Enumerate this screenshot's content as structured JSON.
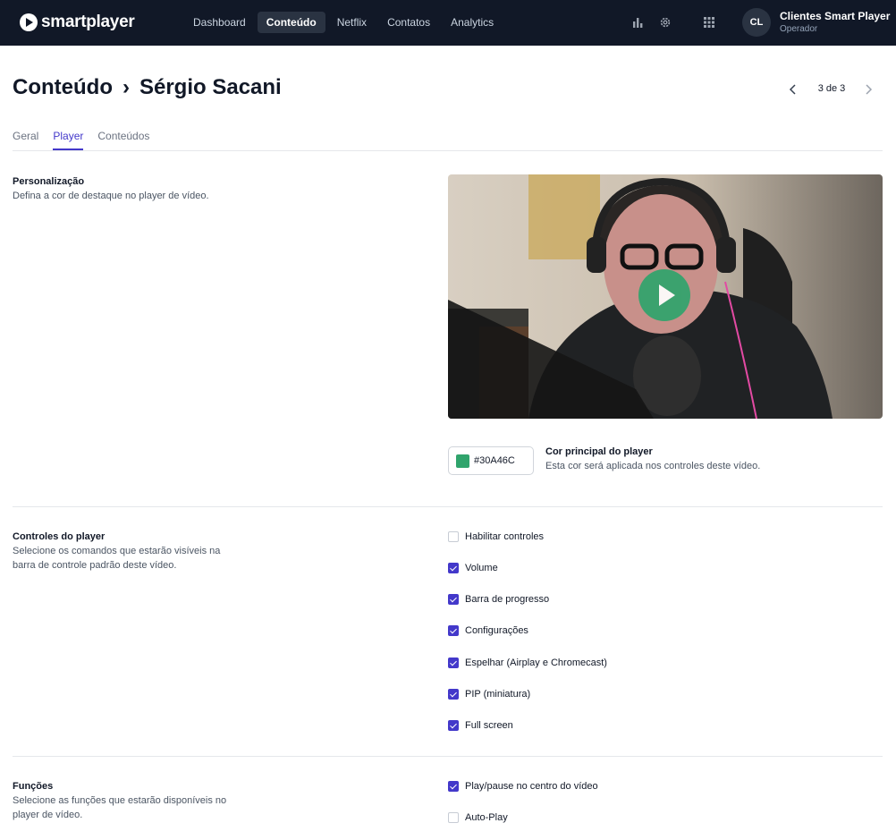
{
  "app": {
    "logo_text": "smartplayer"
  },
  "nav": {
    "items": [
      {
        "label": "Dashboard",
        "active": false
      },
      {
        "label": "Conteúdo",
        "active": true
      },
      {
        "label": "Netflix",
        "active": false
      },
      {
        "label": "Contatos",
        "active": false
      },
      {
        "label": "Analytics",
        "active": false
      }
    ],
    "icons": [
      "bar-chart-icon",
      "gear-icon",
      "apps-grid-icon"
    ]
  },
  "user": {
    "initials": "CL",
    "name": "Clientes Smart Player",
    "role": "Operador"
  },
  "page": {
    "breadcrumb_root": "Conteúdo",
    "breadcrumb_sep": "›",
    "title": "Sérgio Sacani",
    "pager": "3 de 3"
  },
  "tabs": [
    {
      "label": "Geral",
      "active": false
    },
    {
      "label": "Player",
      "active": true
    },
    {
      "label": "Conteúdos",
      "active": false
    }
  ],
  "personalization": {
    "title": "Personalização",
    "desc": "Defina a cor de destaque no player de vídeo.",
    "color_hex": "#30A46C",
    "color_label": "Cor principal do player",
    "color_desc": "Esta cor será aplicada nos controles deste vídeo."
  },
  "controls": {
    "title": "Controles do player",
    "desc": "Selecione os comandos que estarão visíveis na barra de controle padrão deste vídeo.",
    "items": [
      {
        "label": "Habilitar controles",
        "checked": false
      },
      {
        "label": "Volume",
        "checked": true
      },
      {
        "label": "Barra de progresso",
        "checked": true
      },
      {
        "label": "Configurações",
        "checked": true
      },
      {
        "label": "Espelhar (Airplay e Chromecast)",
        "checked": true
      },
      {
        "label": "PIP (miniatura)",
        "checked": true
      },
      {
        "label": "Full screen",
        "checked": true
      }
    ]
  },
  "functions": {
    "title": "Funções",
    "desc": "Selecione as funções que estarão disponíveis no player de vídeo.",
    "items": [
      {
        "label": "Play/pause no centro do vídeo",
        "checked": true
      },
      {
        "label": "Auto-Play",
        "checked": false
      }
    ]
  },
  "colors": {
    "topbar": "#111827",
    "accent": "#4338ca",
    "player": "#30A46C"
  }
}
